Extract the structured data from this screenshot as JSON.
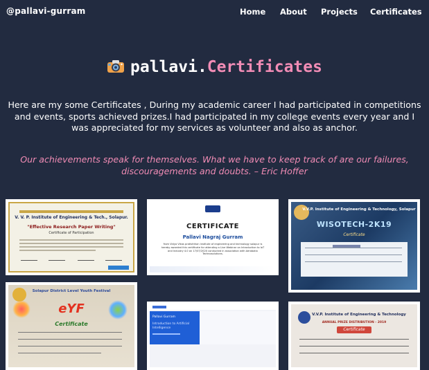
{
  "nav": {
    "brand": "@pallavi-gurram",
    "links": [
      "Home",
      "About",
      "Projects",
      "Certificates"
    ]
  },
  "header": {
    "title_prefix": "pallavi.",
    "title_accent": "Certificates",
    "icon": "camera-icon"
  },
  "intro": "Here are my some Certificates , During my academic career I had participated in competitions and events, sports achieved prizes.I had participated in my college events every year and I was appreciated for my services as volunteer and also as anchor.",
  "quote": "Our achievements speak for themselves. What we have to keep track of are our failures, discouragements and doubts. – Eric Hoffer",
  "certificates": [
    {
      "institute": "V. V. P. Institute of Engineering & Tech., Solapur.",
      "heading": "\"Effective Research Paper Writing\"",
      "subheading": "Certificate of Participation"
    },
    {
      "heading": "CERTIFICATE",
      "name": "Pallavi Nagraj Gurram",
      "body": "from Vidya Vikas pratishthan institute of engineering and technology solapur is hereby awarded this certificate for attending a Live Webinar on Introduction to IoT and Industry 4.0 on 17/07/2020 conducted in association with Aerobotix Technosolutions."
    },
    {
      "institute": "V.V.P. Institute of Engineering & Technology, Solapur",
      "heading": "WISOTECH-2K19",
      "subheading": "Certificate"
    },
    {
      "heading": "eYF",
      "subheading": "Certificate",
      "event": "Solapur District Level Youth Festival"
    },
    {
      "name": "Pallavi Gurram",
      "course": "Introduction to Artificial Intelligence"
    },
    {
      "institute": "V.V.P. Institute of Engineering & Technology",
      "heading": "ANNUAL PRIZE DISTRIBUTION - 2019",
      "subheading": "Certificate"
    }
  ],
  "colors": {
    "background": "#222b40",
    "accent": "#f18cb5",
    "text": "#ffffff"
  }
}
